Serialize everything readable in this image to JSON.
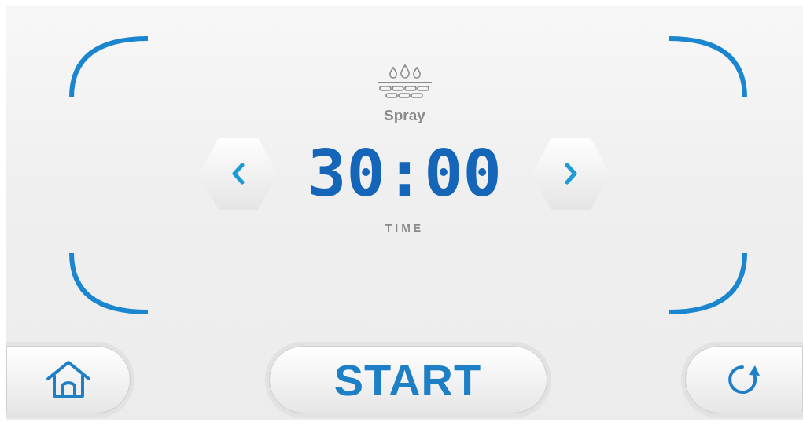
{
  "mode": {
    "label": "Spray"
  },
  "timer": {
    "value": "30:00",
    "label": "TIME"
  },
  "start_button": {
    "label": "START"
  }
}
